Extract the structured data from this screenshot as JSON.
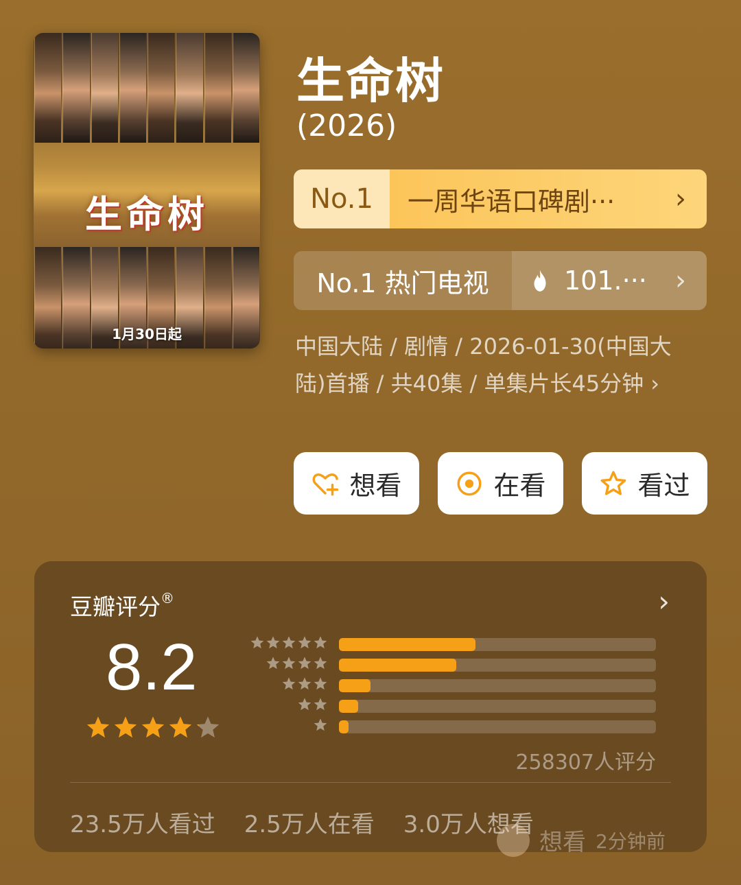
{
  "poster": {
    "title": "生命树",
    "release_text": "1月30日起"
  },
  "title": "生命树",
  "year": "(2026)",
  "rank_weekly": {
    "no": "No.1",
    "label": "一周华语口碑剧···"
  },
  "rank_hot": {
    "label": "No.1 热门电视",
    "value": "101.···"
  },
  "meta_text": "中国大陆 / 剧情 / 2026-01-30(中国大陆)首播 / 共40集 / 单集片长45分钟",
  "actions": [
    {
      "label": "想看",
      "icon": "heart-plus-icon"
    },
    {
      "label": "在看",
      "icon": "target-icon"
    },
    {
      "label": "看过",
      "icon": "star-outline-icon"
    }
  ],
  "rating": {
    "title": "豆瓣评分",
    "reg_mark": "®",
    "score": "8.2",
    "stars": 4.1,
    "distribution": [
      {
        "stars": 5,
        "fraction": 0.43
      },
      {
        "stars": 4,
        "fraction": 0.37
      },
      {
        "stars": 3,
        "fraction": 0.1
      },
      {
        "stars": 2,
        "fraction": 0.06
      },
      {
        "stars": 1,
        "fraction": 0.03
      }
    ],
    "count": "258307人评分",
    "stats": [
      "23.5万人看过",
      "2.5万人在看",
      "3.0万人想看"
    ]
  },
  "overlay": {
    "action": "想看",
    "time": "2分钟前"
  },
  "colors": {
    "accent": "#f6a018",
    "background": "#96692b",
    "card": "#6a4a21"
  }
}
